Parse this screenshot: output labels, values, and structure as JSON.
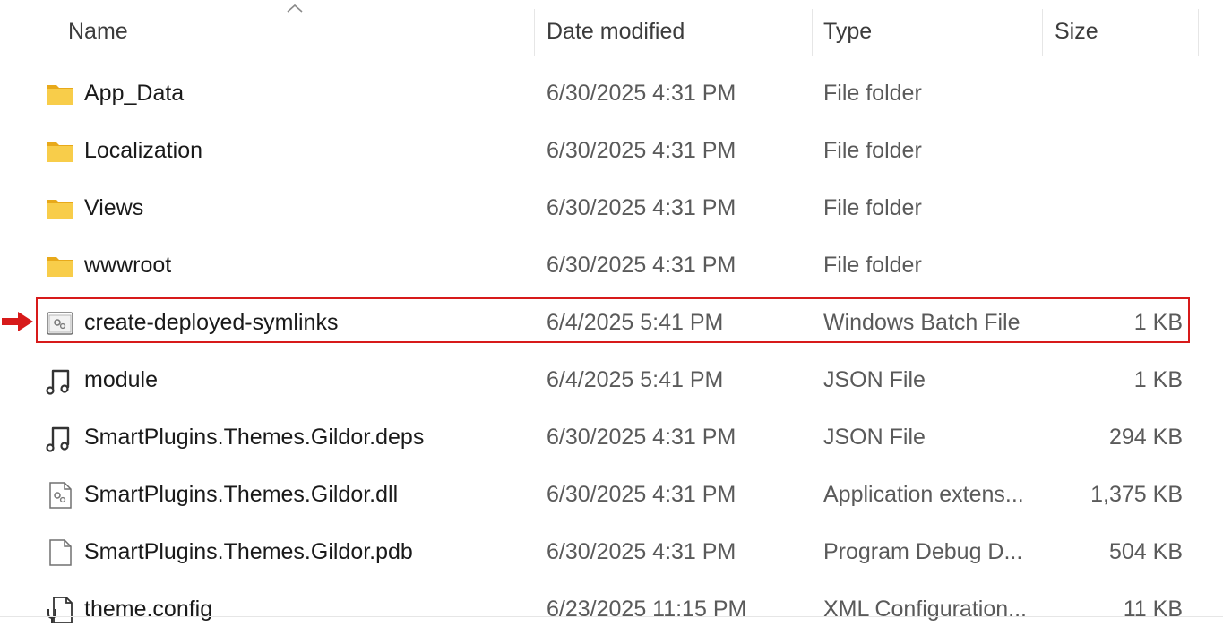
{
  "columns": {
    "name": "Name",
    "date": "Date modified",
    "type": "Type",
    "size": "Size"
  },
  "files": [
    {
      "name": "App_Data",
      "date": "6/30/2025 4:31 PM",
      "type": "File folder",
      "size": "",
      "icon": "folder-icon"
    },
    {
      "name": "Localization",
      "date": "6/30/2025 4:31 PM",
      "type": "File folder",
      "size": "",
      "icon": "folder-icon"
    },
    {
      "name": "Views",
      "date": "6/30/2025 4:31 PM",
      "type": "File folder",
      "size": "",
      "icon": "folder-icon"
    },
    {
      "name": "wwwroot",
      "date": "6/30/2025 4:31 PM",
      "type": "File folder",
      "size": "",
      "icon": "folder-icon"
    },
    {
      "name": "create-deployed-symlinks",
      "date": "6/4/2025 5:41 PM",
      "type": "Windows Batch File",
      "size": "1 KB",
      "icon": "batch-file-icon"
    },
    {
      "name": "module",
      "date": "6/4/2025 5:41 PM",
      "type": "JSON File",
      "size": "1 KB",
      "icon": "json-file-icon"
    },
    {
      "name": "SmartPlugins.Themes.Gildor.deps",
      "date": "6/30/2025 4:31 PM",
      "type": "JSON File",
      "size": "294 KB",
      "icon": "json-file-icon"
    },
    {
      "name": "SmartPlugins.Themes.Gildor.dll",
      "date": "6/30/2025 4:31 PM",
      "type": "Application extens...",
      "size": "1,375 KB",
      "icon": "dll-file-icon"
    },
    {
      "name": "SmartPlugins.Themes.Gildor.pdb",
      "date": "6/30/2025 4:31 PM",
      "type": "Program Debug D...",
      "size": "504 KB",
      "icon": "blank-file-icon"
    },
    {
      "name": "theme.config",
      "date": "6/23/2025 11:15 PM",
      "type": "XML Configuration...",
      "size": "11 KB",
      "icon": "config-file-icon"
    }
  ],
  "colors": {
    "highlight": "#d71a1a",
    "folder": "#f4c542"
  }
}
